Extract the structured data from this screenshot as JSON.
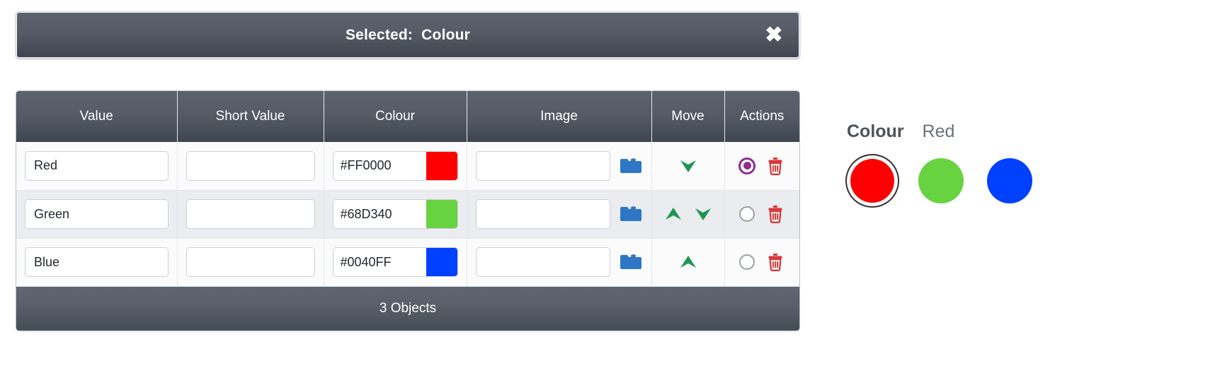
{
  "header": {
    "title": "Selected:  Colour",
    "close_label": "✖",
    "close_icon": "close-icon",
    "bg_start": "#5b626c",
    "bg_end": "#3f454e"
  },
  "table": {
    "columns": [
      "Value",
      "Short Value",
      "Colour",
      "Image",
      "Move",
      "Actions"
    ],
    "rows": [
      {
        "value": "Red",
        "short_value": "",
        "colour_hex": "#FF0000",
        "colour_swatch": "#FF0000",
        "image": "",
        "folder_icon": "folder-icon",
        "move_up": false,
        "move_down": true,
        "selected": true,
        "delete_icon": "trash-icon",
        "radio_icon": "radio-selected-icon"
      },
      {
        "value": "Green",
        "short_value": "",
        "colour_hex": "#68D340",
        "colour_swatch": "#68D340",
        "image": "",
        "folder_icon": "folder-icon",
        "move_up": true,
        "move_down": true,
        "selected": false,
        "delete_icon": "trash-icon",
        "radio_icon": "radio-unselected-icon"
      },
      {
        "value": "Blue",
        "short_value": "",
        "colour_hex": "#0040FF",
        "colour_swatch": "#0040FF",
        "image": "",
        "folder_icon": "folder-icon",
        "move_up": true,
        "move_down": false,
        "selected": false,
        "delete_icon": "trash-icon",
        "radio_icon": "radio-unselected-icon"
      }
    ],
    "footer": "3 Objects",
    "input_placeholder": ""
  },
  "preview": {
    "label": "Colour",
    "value": "Red",
    "swatches": [
      {
        "colour": "#FF0000",
        "name": "Red",
        "selected": true
      },
      {
        "colour": "#68D340",
        "name": "Green",
        "selected": false
      },
      {
        "colour": "#0040FF",
        "name": "Blue",
        "selected": false
      }
    ]
  },
  "colors": {
    "header_bg": "#555c66",
    "footer_bg": "#585f68",
    "folder_blue": "#2f76c7",
    "arrow_green": "#1f9550",
    "trash_red": "#d93333",
    "radio_purple": "#8e2d94",
    "row_alt_bg": "#eaecef"
  }
}
